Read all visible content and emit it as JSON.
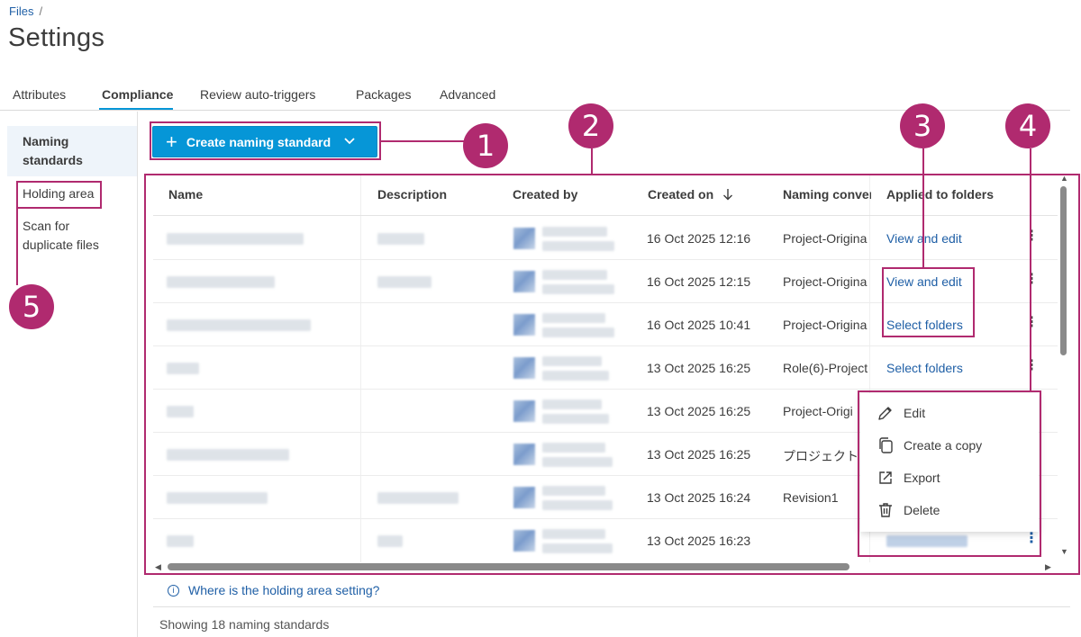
{
  "breadcrumb": {
    "root": "Files",
    "sep": "/"
  },
  "page_title": "Settings",
  "tabs": [
    {
      "label": "Attributes"
    },
    {
      "label": "Compliance"
    },
    {
      "label": "Review auto-triggers"
    },
    {
      "label": "Packages"
    },
    {
      "label": "Advanced"
    }
  ],
  "active_tab": "Compliance",
  "sidebar": {
    "items": [
      {
        "label": "Naming\nstandards",
        "line1": "Naming",
        "line2": "standards"
      },
      {
        "label": "Holding area"
      },
      {
        "label": "Scan for duplicate files",
        "line1": "Scan for",
        "line2": "duplicate files"
      }
    ]
  },
  "create_button": {
    "label": "Create naming standard"
  },
  "table": {
    "columns": [
      "Name",
      "Description",
      "Created by",
      "Created on",
      "Naming conver",
      "Applied to folders"
    ],
    "sort_icon": "arrow-down-icon",
    "rows": [
      {
        "created_on": "16 Oct 2025 12:16",
        "convention": "Project-Origina",
        "applied": "View and edit"
      },
      {
        "created_on": "16 Oct 2025 12:15",
        "convention": "Project-Origina",
        "applied": "View and edit"
      },
      {
        "created_on": "16 Oct 2025 10:41",
        "convention": "Project-Origina",
        "applied": "Select folders"
      },
      {
        "created_on": "13 Oct 2025 16:25",
        "convention": "Role(6)-Project",
        "applied": "Select folders"
      },
      {
        "created_on": "13 Oct 2025 16:25",
        "convention": "Project-Origi",
        "applied": ""
      },
      {
        "created_on": "13 Oct 2025 16:25",
        "convention": "プロジェクト",
        "applied": ""
      },
      {
        "created_on": "13 Oct 2025 16:24",
        "convention": "Revision1",
        "applied": ""
      },
      {
        "created_on": "13 Oct 2025 16:23",
        "convention": "",
        "applied": ""
      }
    ]
  },
  "context_menu": {
    "items": [
      {
        "label": "Edit",
        "icon": "pencil-icon"
      },
      {
        "label": "Create a copy",
        "icon": "copy-icon"
      },
      {
        "label": "Export",
        "icon": "export-icon"
      },
      {
        "label": "Delete",
        "icon": "trash-icon"
      }
    ]
  },
  "info_link": "Where is the holding area setting?",
  "footer": "Showing 18 naming standards",
  "callouts": [
    "1",
    "2",
    "3",
    "4",
    "5"
  ],
  "colors": {
    "accent": "#0696d7",
    "link": "#1f5fa6",
    "annotation": "#b02a6f"
  }
}
